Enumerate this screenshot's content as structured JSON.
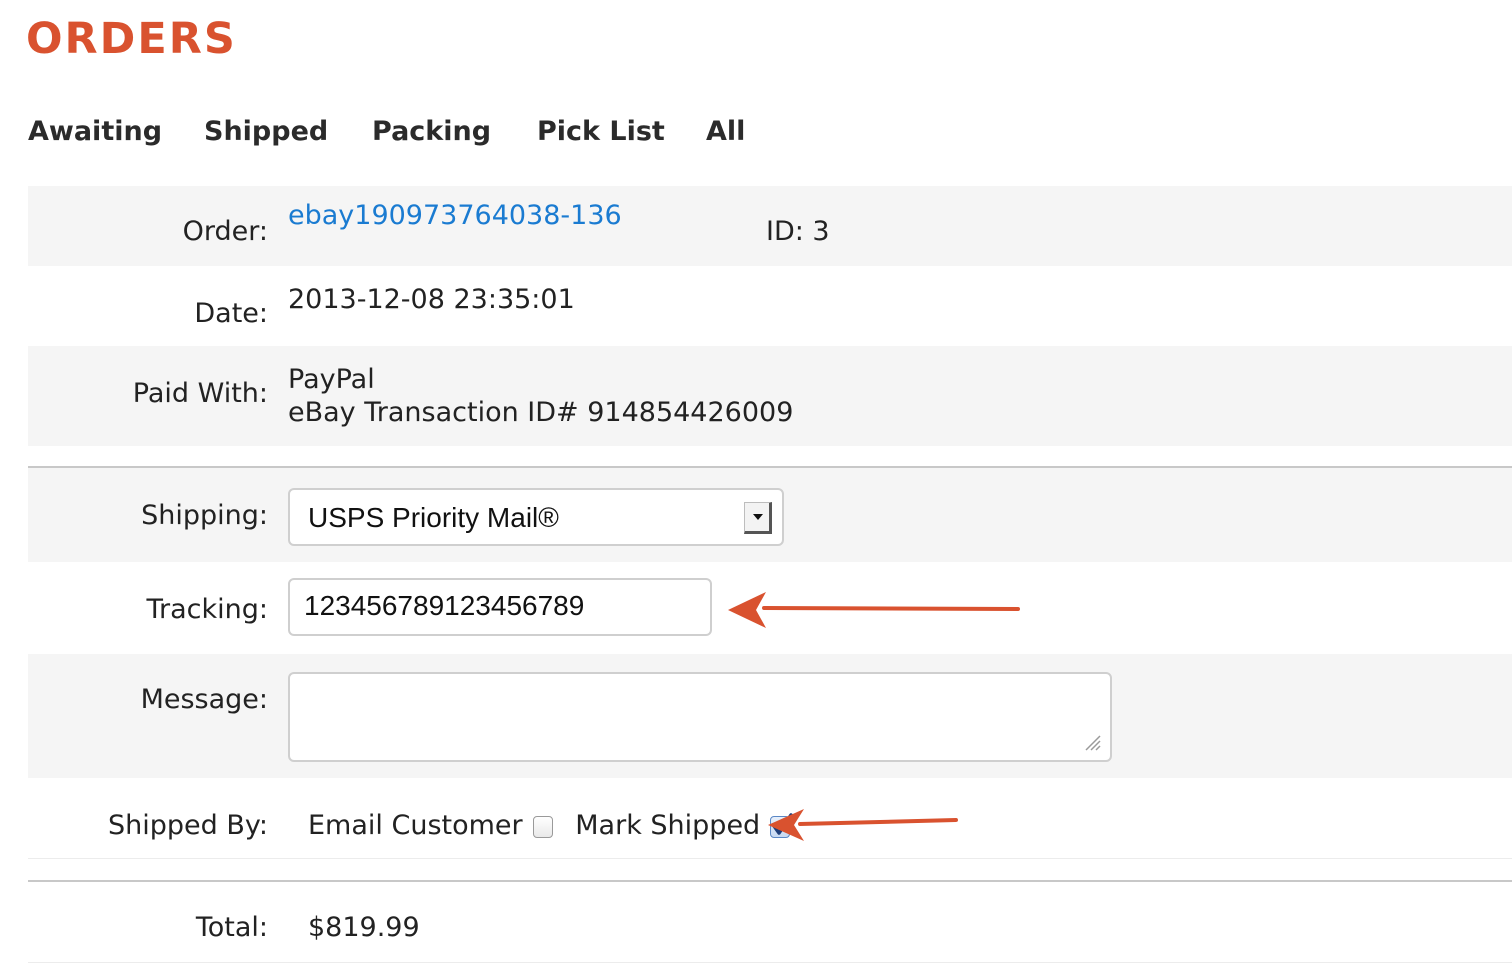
{
  "page": {
    "title": "ORDERS"
  },
  "tabs": [
    {
      "label": "Awaiting"
    },
    {
      "label": "Shipped"
    },
    {
      "label": "Packing"
    },
    {
      "label": "Pick List"
    },
    {
      "label": "All"
    }
  ],
  "order": {
    "order_label": "Order:",
    "order_number": "ebay190973764038-136",
    "id_text": "ID: 3",
    "date_label": "Date:",
    "date_value": "2013-12-08 23:35:01",
    "paid_label": "Paid With:",
    "paid_method": "PayPal",
    "paid_transaction": "eBay Transaction ID# 914854426009"
  },
  "shipping": {
    "shipping_label": "Shipping:",
    "shipping_selected": "USPS Priority Mail®",
    "tracking_label": "Tracking:",
    "tracking_value": "123456789123456789",
    "message_label": "Message:",
    "message_value": "",
    "shipped_by_label": "Shipped By:",
    "email_customer_label": "Email Customer",
    "email_customer_checked": false,
    "mark_shipped_label": "Mark Shipped",
    "mark_shipped_checked": true
  },
  "total": {
    "total_label": "Total:",
    "total_value": "$819.99"
  },
  "colors": {
    "title": "#d9522f",
    "link": "#1a7bd1",
    "annotation_arrow": "#d9522f",
    "row_shade": "#f5f5f5"
  }
}
